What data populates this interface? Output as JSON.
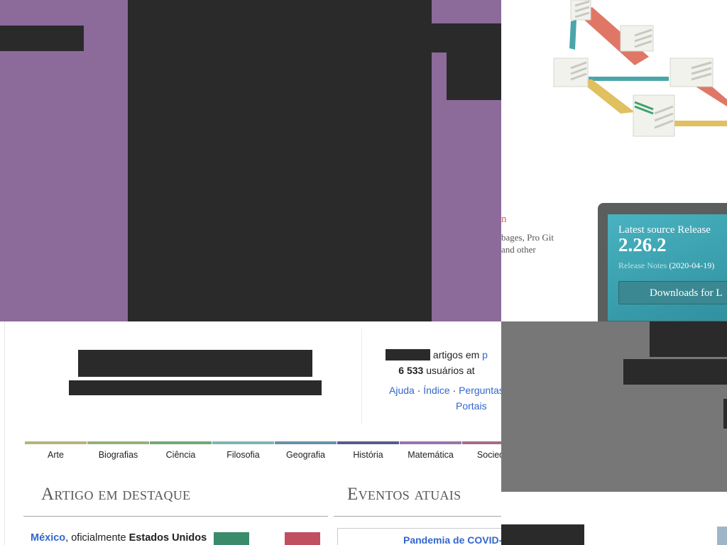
{
  "wiki": {
    "stats_line1_suffix": "artigos em",
    "stats_line1_link": "p",
    "stats_users_count": "6 533",
    "stats_users_suffix": "usuários at",
    "help_links": [
      "Ajuda",
      "Índice",
      "Perguntas"
    ],
    "help_separator": " · ",
    "portais": "Portais",
    "categories": [
      {
        "label": "Arte",
        "color": "#b5b57b"
      },
      {
        "label": "Biografias",
        "color": "#97b07d"
      },
      {
        "label": "Ciência",
        "color": "#72a873"
      },
      {
        "label": "Filosofia",
        "color": "#7fb5b0"
      },
      {
        "label": "Geografia",
        "color": "#6b8fa9"
      },
      {
        "label": "História",
        "color": "#5a5a8c"
      },
      {
        "label": "Matemática",
        "color": "#9b73a8"
      },
      {
        "label": "Socieda",
        "color": "#a36b86"
      }
    ],
    "featured_title": "Artigo em destaque",
    "current_events_title": "Eventos atuais",
    "featured_text_link": "México",
    "featured_text_middle": ", oficialmente ",
    "featured_text_bold": "Estados Unidos",
    "covid_link": "Pandemia de COVID-"
  },
  "git": {
    "orange_text": "n",
    "desc_line1": "bages, Pro Git",
    "desc_line2": "and other",
    "release_title": "Latest source Release",
    "release_version": "2.26.2",
    "release_notes_link": "Release Notes",
    "release_date": "(2020-04-19)",
    "download_button": "Downloads for L"
  }
}
